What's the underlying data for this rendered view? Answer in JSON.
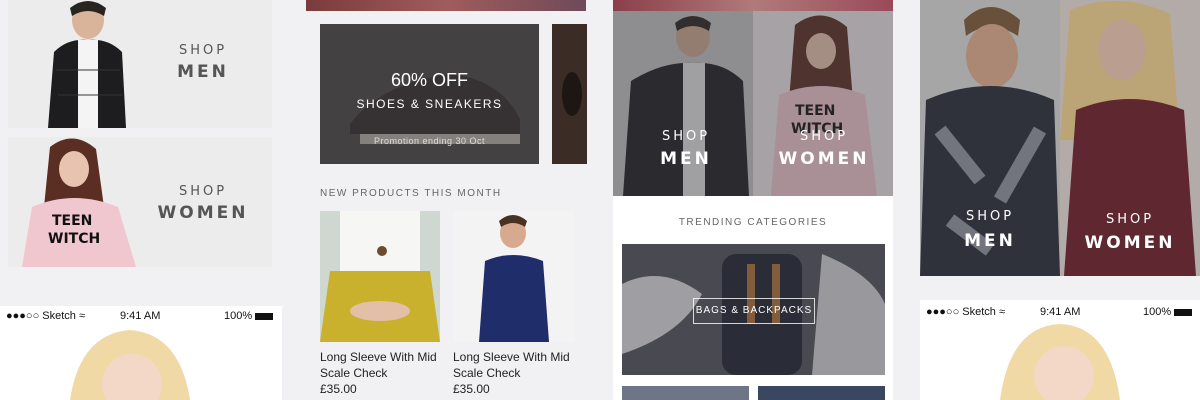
{
  "col1": {
    "men": {
      "shop": "SHOP",
      "label": "MEN"
    },
    "women": {
      "shop": "SHOP",
      "label": "WOMEN"
    },
    "status": {
      "carrier": "Sketch",
      "time": "9:41 AM",
      "battery": "100%"
    }
  },
  "col2": {
    "promo": {
      "headline": "60% OFF",
      "subtitle": "SHOES & SNEAKERS",
      "note": "Promotion ending 30 Oct"
    },
    "section_title": "NEW PRODUCTS THIS MONTH",
    "products": [
      {
        "name": "Long Sleeve With Mid Scale Check",
        "price": "£35.00"
      },
      {
        "name": "Long Sleeve With Mid Scale Check",
        "price": "£35.00"
      }
    ]
  },
  "col3": {
    "men": {
      "shop": "SHOP",
      "label": "MEN"
    },
    "women": {
      "shop": "SHOP",
      "label": "WOMEN"
    },
    "section_title": "TRENDING CATEGORIES",
    "category": "BAGS & BACKPACKS"
  },
  "col4": {
    "men": {
      "shop": "SHOP",
      "label": "MEN"
    },
    "women": {
      "shop": "SHOP",
      "label": "WOMEN"
    },
    "status": {
      "carrier": "Sketch",
      "time": "9:41 AM",
      "battery": "100%"
    }
  },
  "colors": {
    "background": "#f1f1f3",
    "card": "#ececec",
    "overlay": "#3f3c40"
  }
}
